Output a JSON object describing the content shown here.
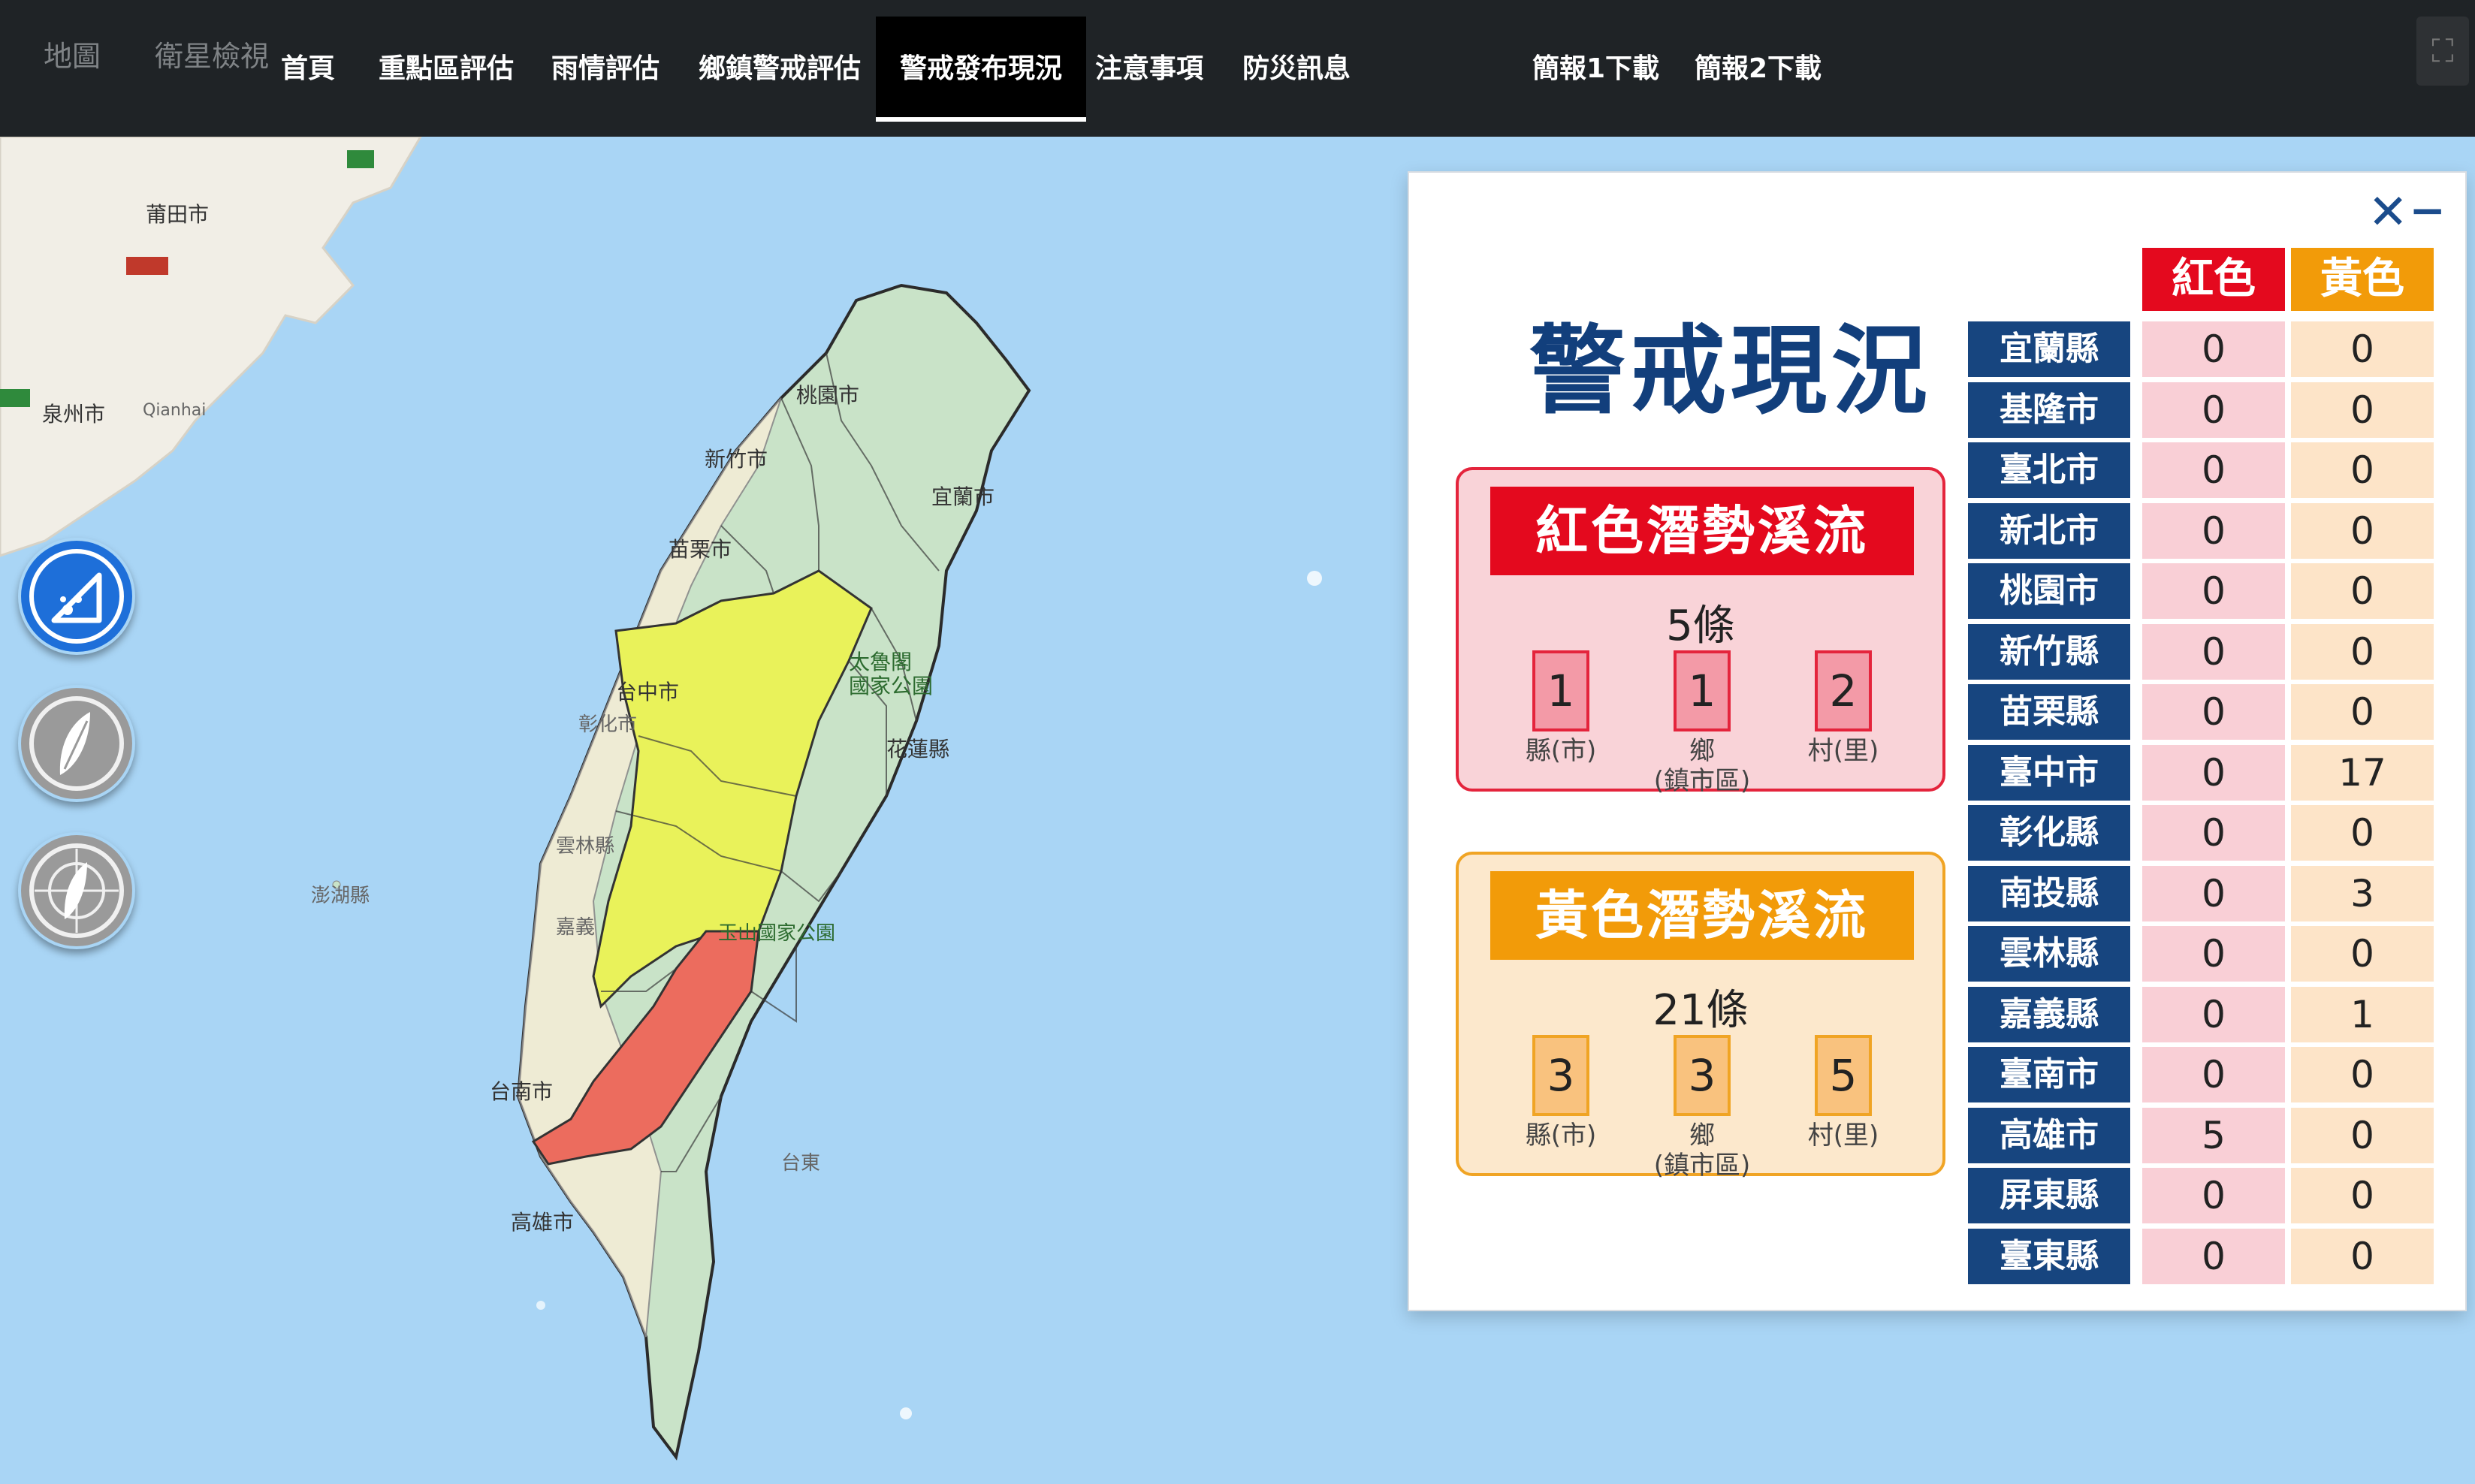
{
  "map_type": {
    "map": "地圖",
    "satellite": "衛星檢視"
  },
  "nav": [
    {
      "label": "首頁",
      "active": false
    },
    {
      "label": "重點區評估",
      "active": false
    },
    {
      "label": "雨情評估",
      "active": false
    },
    {
      "label": "鄉鎮警戒評估",
      "active": false
    },
    {
      "label": "警戒發布現況",
      "active": true
    },
    {
      "label": "注意事項",
      "active": false
    },
    {
      "label": "防災訊息",
      "active": false
    }
  ],
  "downloads": [
    "簡報1下載",
    "簡報2下載"
  ],
  "map_labels": {
    "putian": "莆田市",
    "quanzhou": "泉州市",
    "qianhai": "Qianhai",
    "taoyuan": "桃園市",
    "hsinchu": "新竹市",
    "yilan": "宜蘭市",
    "miaoli": "苗栗市",
    "taichung": "台中市",
    "changhua": "彰化市",
    "taroko": "太魯閣\n國家公園",
    "hualien": "花蓮縣",
    "yunlin": "雲林縣",
    "chiayi": "嘉義",
    "penghu": "澎湖縣",
    "yushan": "玉山國家公園",
    "tainan": "台南市",
    "kaohsiung": "高雄市",
    "taitung": "台東"
  },
  "panel": {
    "title": "警戒現況",
    "close_icon": "✕",
    "minimize_icon": "−",
    "red": {
      "header": "紅色潛勢溪流",
      "total": "5條",
      "counts": {
        "county": "1",
        "township": "1",
        "village": "2"
      }
    },
    "yellow": {
      "header": "黃色潛勢溪流",
      "total": "21條",
      "counts": {
        "county": "3",
        "township": "3",
        "village": "5"
      }
    },
    "labels": {
      "county": "縣(市)",
      "township": "鄉\n(鎮市區)",
      "village": "村(里)"
    },
    "table": {
      "headers": {
        "red": "紅色",
        "yellow": "黃色"
      },
      "rows": [
        {
          "county": "宜蘭縣",
          "red": "0",
          "yellow": "0"
        },
        {
          "county": "基隆市",
          "red": "0",
          "yellow": "0"
        },
        {
          "county": "臺北市",
          "red": "0",
          "yellow": "0"
        },
        {
          "county": "新北市",
          "red": "0",
          "yellow": "0"
        },
        {
          "county": "桃園市",
          "red": "0",
          "yellow": "0"
        },
        {
          "county": "新竹縣",
          "red": "0",
          "yellow": "0"
        },
        {
          "county": "苗栗縣",
          "red": "0",
          "yellow": "0"
        },
        {
          "county": "臺中市",
          "red": "0",
          "yellow": "17"
        },
        {
          "county": "彰化縣",
          "red": "0",
          "yellow": "0"
        },
        {
          "county": "南投縣",
          "red": "0",
          "yellow": "3"
        },
        {
          "county": "雲林縣",
          "red": "0",
          "yellow": "0"
        },
        {
          "county": "嘉義縣",
          "red": "0",
          "yellow": "1"
        },
        {
          "county": "臺南市",
          "red": "0",
          "yellow": "0"
        },
        {
          "county": "高雄市",
          "red": "5",
          "yellow": "0"
        },
        {
          "county": "屏東縣",
          "red": "0",
          "yellow": "0"
        },
        {
          "county": "臺東縣",
          "red": "0",
          "yellow": "0"
        }
      ]
    }
  },
  "colors": {
    "red_alert": "#e4091e",
    "yellow_alert": "#f29b09",
    "county_bg": "#17457f",
    "map_sea": "#a9d5f5",
    "map_land_green": "#c9e3c8",
    "map_zone_yellow": "#e9f25a",
    "map_zone_red": "#ec6c5e"
  },
  "icons": [
    "debris-flow-icon",
    "taiwan-leaf-icon",
    "taiwan-radar-icon",
    "fullscreen-icon"
  ]
}
